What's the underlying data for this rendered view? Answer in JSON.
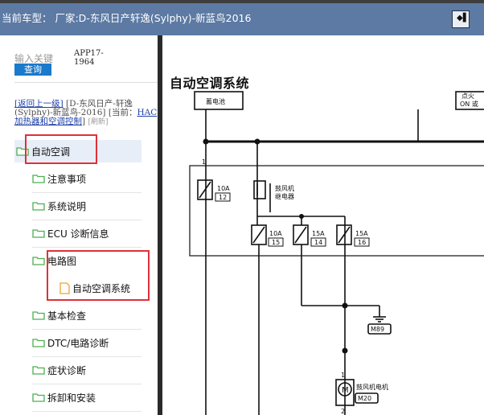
{
  "header": {
    "title": "当前车型： 厂家:D-东风日产轩逸(Sylphy)-新蓝鸟2016",
    "exit_icon": "exit-icon"
  },
  "sidebar": {
    "search_placeholder": "输入关键",
    "query_button": "查询",
    "app_code": "APP17-1964",
    "breadcrumb": {
      "back_link": "[返回上一级]",
      "vehicle": "[D-东风日产-轩逸(Sylphy)-新蓝鸟-2016]",
      "current_prefix": "[当前：",
      "current_link": "HAC 加热器和空调控制",
      "current_suffix": "]",
      "refresh": "[刷新]"
    },
    "tree": [
      {
        "label": "自动空调",
        "icon": "folder-open-icon",
        "level": 0,
        "selected": true
      },
      {
        "label": "注意事项",
        "icon": "folder-icon",
        "level": 1
      },
      {
        "label": "系统说明",
        "icon": "folder-icon",
        "level": 1
      },
      {
        "label": "ECU 诊断信息",
        "icon": "folder-icon",
        "level": 1
      },
      {
        "label": "电路图",
        "icon": "folder-open-icon",
        "level": 1
      },
      {
        "label": "自动空调系统",
        "icon": "document-icon",
        "level": 2
      },
      {
        "label": "基本检查",
        "icon": "folder-icon",
        "level": 1
      },
      {
        "label": "DTC/电路诊断",
        "icon": "folder-icon",
        "level": 1
      },
      {
        "label": "症状诊断",
        "icon": "folder-icon",
        "level": 1
      },
      {
        "label": "拆卸和安装",
        "icon": "folder-icon",
        "level": 1
      }
    ]
  },
  "diagram": {
    "title": "自动空调系统",
    "battery_label": "蓄电池",
    "ignition_label_1": "点火",
    "ignition_label_2": "ON 或",
    "fuse_1": {
      "rating": "10A",
      "number": "12"
    },
    "blower_relay_label_1": "鼓风机",
    "blower_relay_label_2": "继电器",
    "fuse_2": {
      "rating": "10A",
      "number": "15"
    },
    "fuse_3": {
      "rating": "15A",
      "number": "14"
    },
    "fuse_4": {
      "rating": "15A",
      "number": "16"
    },
    "ground_label": "M89",
    "motor_symbol": "M",
    "motor_label": "鼓风机电机",
    "motor_code": "M20",
    "pin_1": "1",
    "pin_1b": "1",
    "pin_2": "2"
  },
  "colors": {
    "header_bg": "#5c7aa3",
    "button_bg": "#1a7acb",
    "highlight_red": "#e0303a",
    "folder_green": "#4caf50",
    "document_orange": "#f0a030"
  }
}
